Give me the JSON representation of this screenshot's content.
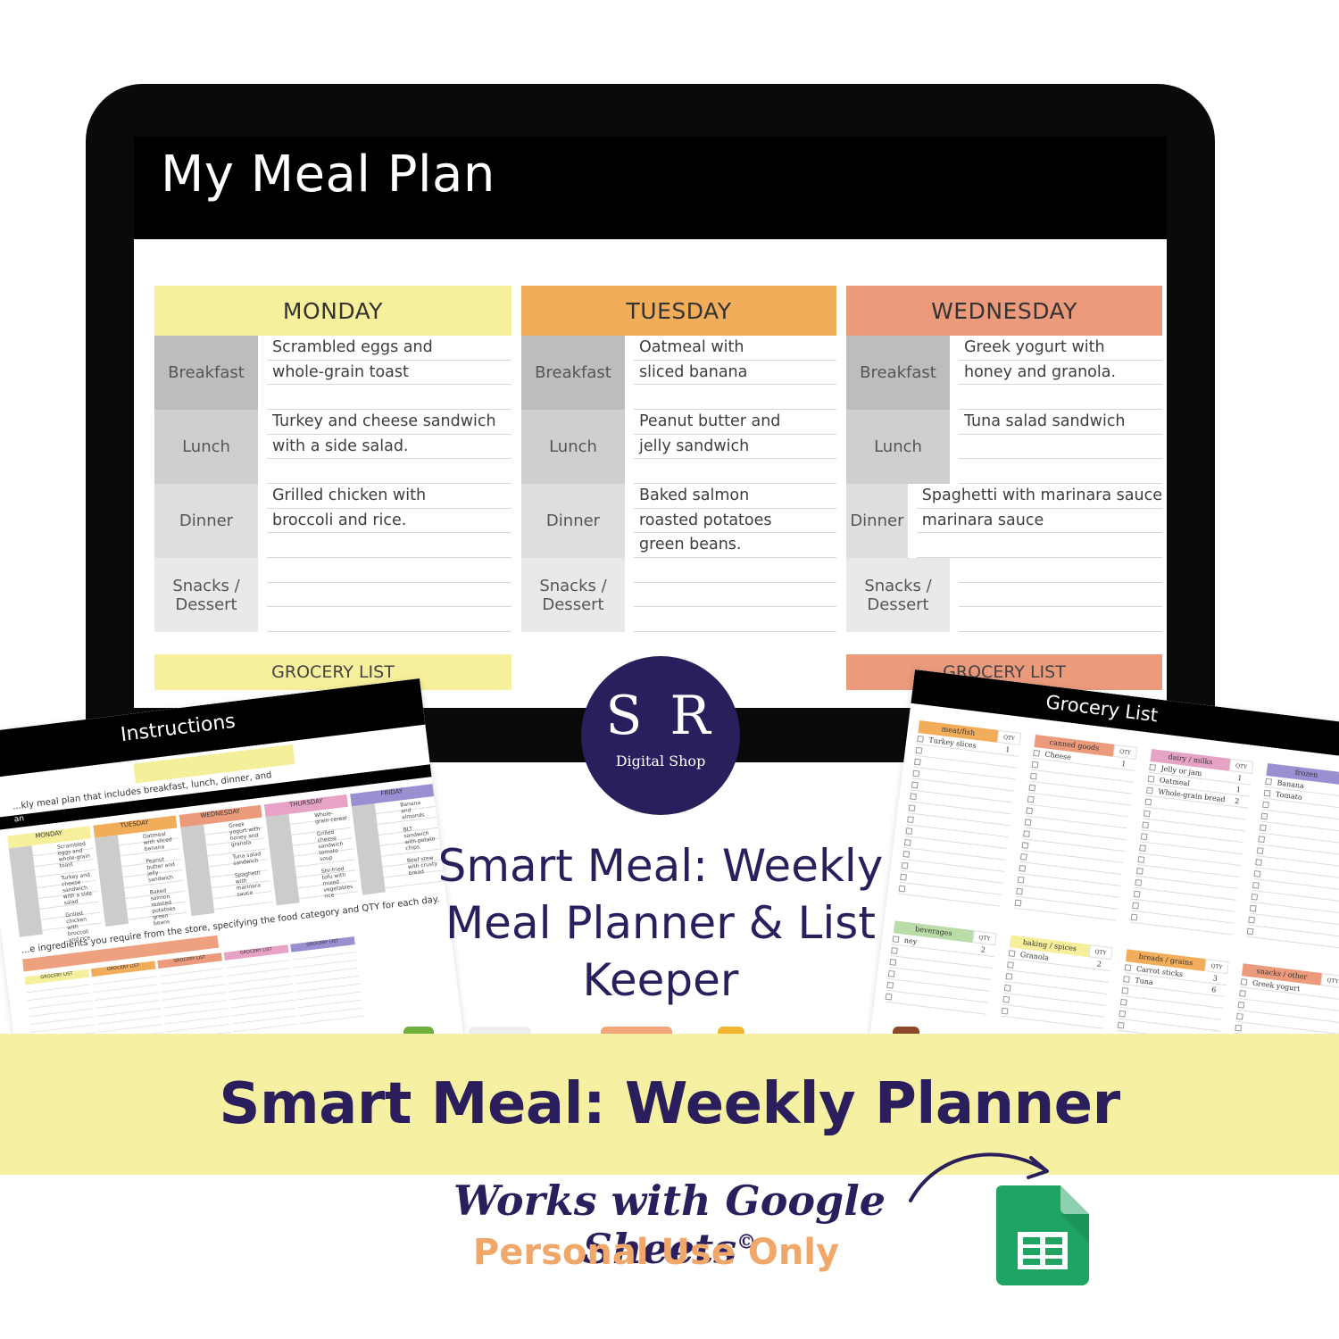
{
  "colors": {
    "monday": "#f6ef9b",
    "tuesday": "#f2ad5a",
    "wednesday": "#eb9a7c",
    "brand_navy": "#2a1f5c",
    "banner": "#f6f0a3",
    "personal_use": "#f0a86a"
  },
  "screen": {
    "title": "My Meal Plan",
    "days": [
      {
        "name": "MONDAY",
        "meals": [
          {
            "label": "Breakfast",
            "lines": [
              "Scrambled eggs and",
              "whole-grain toast",
              ""
            ]
          },
          {
            "label": "Lunch",
            "lines": [
              "Turkey and cheese sandwich",
              "with a side salad.",
              ""
            ]
          },
          {
            "label": "Dinner",
            "lines": [
              "Grilled chicken with",
              "broccoli and rice.",
              ""
            ]
          },
          {
            "label": "Snacks / Dessert",
            "lines": [
              "",
              "",
              ""
            ]
          }
        ]
      },
      {
        "name": "TUESDAY",
        "meals": [
          {
            "label": "Breakfast",
            "lines": [
              "Oatmeal with",
              "sliced banana",
              ""
            ]
          },
          {
            "label": "Lunch",
            "lines": [
              "Peanut butter and",
              "jelly sandwich",
              ""
            ]
          },
          {
            "label": "Dinner",
            "lines": [
              "Baked salmon",
              "roasted potatoes",
              "green beans."
            ]
          },
          {
            "label": "Snacks / Dessert",
            "lines": [
              "",
              "",
              ""
            ]
          }
        ]
      },
      {
        "name": "WEDNESDAY",
        "meals": [
          {
            "label": "Breakfast",
            "lines": [
              "Greek yogurt with",
              "honey and granola.",
              ""
            ]
          },
          {
            "label": "Lunch",
            "lines": [
              "Tuna salad sandwich",
              "",
              ""
            ]
          },
          {
            "label": "Dinner",
            "lines": [
              "Spaghetti with marinara sauce",
              "marinara sauce",
              ""
            ]
          },
          {
            "label": "Snacks / Dessert",
            "lines": [
              "",
              "",
              ""
            ]
          }
        ]
      }
    ],
    "grocery_peek_left": "GROCERY LIST",
    "grocery_peek_right": "GROCERY LIST"
  },
  "left_sheet": {
    "title": "Instructions",
    "intro": "...kly meal plan that includes breakfast, lunch, dinner, and",
    "bar_label": "an",
    "days": [
      {
        "name": "MONDAY",
        "lines": [
          "Scrambled eggs and whole-grain toast",
          "Turkey and cheese sandwich with a side salad",
          "Grilled chicken with broccoli and rice"
        ]
      },
      {
        "name": "TUESDAY",
        "lines": [
          "Oatmeal with sliced banana",
          "Peanut butter and jelly sandwich",
          "Baked salmon roasted potatoes green beans"
        ]
      },
      {
        "name": "WEDNESDAY",
        "lines": [
          "Greek yogurt with honey and granola",
          "Tuna salad sandwich",
          "Spaghetti with marinara sauce"
        ]
      },
      {
        "name": "THURSDAY",
        "lines": [
          "Whole-grain cereal",
          "Grilled cheese sandwich tomato soup",
          "Stir-fried tofu with mixed vegetables rice"
        ]
      },
      {
        "name": "FRIDAY",
        "lines": [
          "Banana and almonds",
          "BLT sandwich with potato chips",
          "Beef stew with crusty bread"
        ]
      }
    ],
    "grocery_instructions": "...e ingredients you require from the store, specifying the food category and QTY for each day.",
    "grocery_header": "GROCERY LIST"
  },
  "right_sheet": {
    "title": "Grocery List",
    "qty_label": "QTY",
    "categories_top": [
      {
        "name": "meat/fish",
        "color": "#f2ad5a",
        "items": [
          {
            "name": "Turkey slices",
            "qty": "1"
          }
        ]
      },
      {
        "name": "canned goods",
        "color": "#eb9a7c",
        "items": [
          {
            "name": "Cheese",
            "qty": "1"
          }
        ]
      },
      {
        "name": "dairy / milks",
        "color": "#e6a3c6",
        "items": [
          {
            "name": "Jelly or jam",
            "qty": "1"
          },
          {
            "name": "Oatmeal",
            "qty": "1"
          },
          {
            "name": "Whole-grain bread",
            "qty": "2"
          }
        ]
      },
      {
        "name": "frozen",
        "color": "#9a8fd0",
        "items": [
          {
            "name": "Banana",
            "qty": ""
          },
          {
            "name": "Tomato",
            "qty": ""
          }
        ]
      }
    ],
    "categories_bottom": [
      {
        "name": "beverages",
        "color": "#b9dca8",
        "items": [
          {
            "name": "ney",
            "qty": "2"
          }
        ]
      },
      {
        "name": "baking / spices",
        "color": "#f6ef9b",
        "items": [
          {
            "name": "Granola",
            "qty": "2"
          }
        ]
      },
      {
        "name": "breads / grains",
        "color": "#f2ad5a",
        "items": [
          {
            "name": "Carrot sticks",
            "qty": "3"
          },
          {
            "name": "Tuna",
            "qty": "6"
          }
        ]
      },
      {
        "name": "snacks / other",
        "color": "#eb9a7c",
        "items": [
          {
            "name": "Greek yogurt",
            "qty": ""
          }
        ]
      }
    ]
  },
  "logo": {
    "initials": "S R",
    "subtitle": "Digital Shop"
  },
  "center_title": [
    "Smart Meal: Weekly",
    "Meal Planner & List",
    "Keeper"
  ],
  "banner": {
    "title": "Smart Meal: Weekly Planner"
  },
  "footer": {
    "works_with": "Works with Google Sheets",
    "copyright": "©",
    "personal_use": "Personal Use Only"
  },
  "icons": {
    "arrow": "curved-arrow-icon",
    "sheets": "google-sheets-icon"
  }
}
